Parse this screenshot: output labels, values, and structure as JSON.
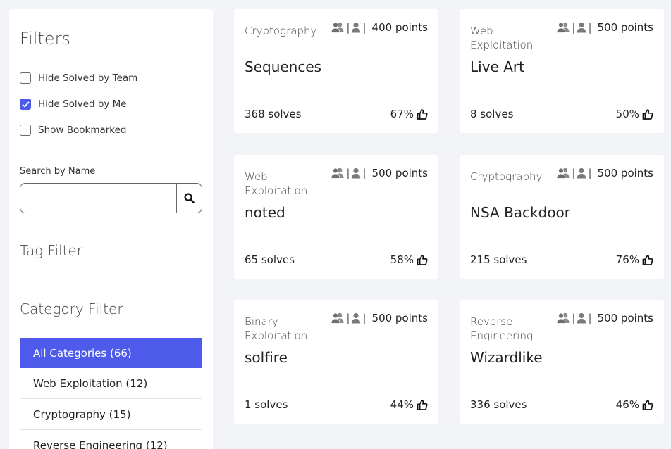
{
  "sidebar": {
    "title": "Filters",
    "checkboxes": [
      {
        "label": "Hide Solved by Team",
        "checked": false
      },
      {
        "label": "Hide Solved by Me",
        "checked": true
      },
      {
        "label": "Show Bookmarked",
        "checked": false
      }
    ],
    "search": {
      "label": "Search by Name",
      "value": "",
      "placeholder": ""
    },
    "tag_filter_title": "Tag Filter",
    "category_filter_title": "Category Filter",
    "categories": [
      {
        "label": "All Categories  (66)",
        "active": true
      },
      {
        "label": "Web Exploitation (12)",
        "active": false
      },
      {
        "label": "Cryptography (15)",
        "active": false
      },
      {
        "label": "Reverse Engineering (12)",
        "active": false
      }
    ]
  },
  "icons": {
    "team": "users-icon",
    "me": "user-icon",
    "search": "search-icon",
    "rating": "thumbs-up-icon"
  },
  "colors": {
    "accent": "#4e5bea",
    "background": "#f3f4f8",
    "icon_gray": "#7a7a7a"
  },
  "challenges": [
    {
      "category": "Cryptography",
      "points": "400 points",
      "name": "Sequences",
      "solves": "368 solves",
      "rating": "67%"
    },
    {
      "category": "Web Exploitation",
      "points": "500 points",
      "name": "Live Art",
      "solves": "8 solves",
      "rating": "50%"
    },
    {
      "category": "Web Exploitation",
      "points": "500 points",
      "name": "noted",
      "solves": "65 solves",
      "rating": "58%"
    },
    {
      "category": "Cryptography",
      "points": "500 points",
      "name": "NSA Backdoor",
      "solves": "215 solves",
      "rating": "76%"
    },
    {
      "category": "Binary Exploitation",
      "points": "500 points",
      "name": "solfire",
      "solves": "1 solves",
      "rating": "44%"
    },
    {
      "category": "Reverse Engineering",
      "points": "500 points",
      "name": "Wizardlike",
      "solves": "336 solves",
      "rating": "46%"
    }
  ]
}
